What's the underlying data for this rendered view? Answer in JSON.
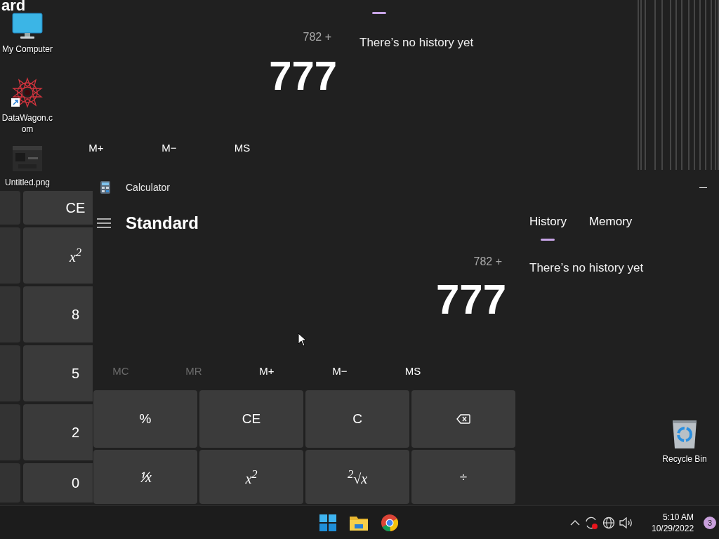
{
  "desktop_icons": [
    {
      "label": "My Computer",
      "kind": "computer"
    },
    {
      "label": "DataWagon.com",
      "kind": "shortcut"
    },
    {
      "label": "Untitled.png",
      "kind": "image"
    }
  ],
  "background_window": {
    "heading_fragment": "ard",
    "expression": "782 +",
    "display": "777",
    "history_message": "There’s no history yet",
    "memory_buttons": [
      {
        "label": "M+"
      },
      {
        "label": "M−"
      },
      {
        "label": "MS"
      }
    ],
    "keys": [
      {
        "label": "CE",
        "kind": "text"
      },
      {
        "label": "x$^{2}$",
        "kind": "math"
      },
      {
        "label": "8",
        "kind": "text"
      },
      {
        "label": "5",
        "kind": "text"
      },
      {
        "label": "2",
        "kind": "text"
      },
      {
        "label": "0",
        "kind": "text"
      }
    ]
  },
  "calculator": {
    "title": "Calculator",
    "mode": "Standard",
    "expression": "782 +",
    "display": "777",
    "memory_buttons": [
      {
        "label": "MC",
        "disabled": true
      },
      {
        "label": "MR",
        "disabled": true
      },
      {
        "label": "M+",
        "disabled": false
      },
      {
        "label": "M−",
        "disabled": false
      },
      {
        "label": "MS",
        "disabled": false
      }
    ],
    "keys": [
      {
        "label": "%",
        "kind": "text"
      },
      {
        "label": "CE",
        "kind": "text"
      },
      {
        "label": "C",
        "kind": "text"
      },
      {
        "kind": "backspace"
      },
      {
        "label": "⅟x",
        "kind": "math"
      },
      {
        "label": "x$^{2}$",
        "kind": "math"
      },
      {
        "label": "$^{2}$√x",
        "kind": "math"
      },
      {
        "label": "÷",
        "kind": "text"
      }
    ],
    "tabs": [
      {
        "label": "History",
        "selected": true
      },
      {
        "label": "Memory",
        "selected": false
      }
    ],
    "history_message": "There’s no history yet"
  },
  "recycle_bin": {
    "label": "Recycle Bin"
  },
  "taskbar": {
    "time": "5:10 AM",
    "date": "10/29/2022",
    "notification_count": "3"
  }
}
